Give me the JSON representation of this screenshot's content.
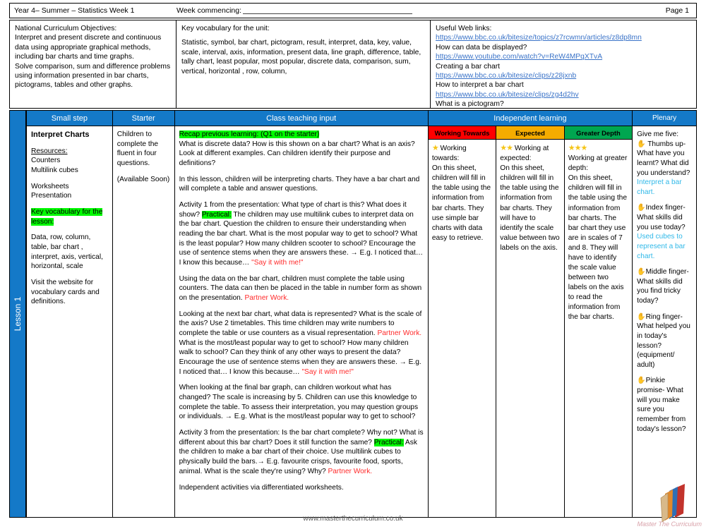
{
  "header": {
    "year_term": "Year 4– Summer – Statistics Week 1",
    "week_commencing_label": "Week commencing:",
    "page": "Page 1"
  },
  "info": {
    "nc": {
      "heading": "National Curriculum Objectives:",
      "body1": "Interpret and present discrete and continuous data using appropriate graphical methods, including bar charts and time graphs.",
      "body2": "Solve comparison, sum and difference problems using information presented in bar charts, pictograms, tables and other graphs."
    },
    "vocab": {
      "heading": "Key vocabulary for the unit:",
      "body": "Statistic, symbol, bar chart, pictogram, result, interpret, data, key, value, scale, interval, axis, information, present data, line graph, difference, table, tally chart, least popular, most popular, discrete data, comparison, sum, vertical, horizontal , row, column,"
    },
    "links": {
      "heading": "Useful Web links:",
      "items": [
        {
          "url": "https://www.bbc.co.uk/bitesize/topics/z7rcwmn/articles/z8dp8mn",
          "caption": "How can data be displayed?"
        },
        {
          "url": "https://www.youtube.com/watch?v=ReW4MPqXTvA",
          "caption": "Creating a bar chart"
        },
        {
          "url": "https://www.bbc.co.uk/bitesize/clips/z28jxnb",
          "caption": "How to interpret a bar chart"
        },
        {
          "url": "https://www.bbc.co.uk/bitesize/clips/zg4d2hv",
          "caption": "What is a pictogram?"
        }
      ]
    }
  },
  "lesson_strip": {
    "label": "Lesson 1"
  },
  "columns": {
    "small_step": "Small step",
    "starter": "Starter",
    "class_teaching": "Class teaching input",
    "independent": "Independent learning",
    "plenary": "Plenary"
  },
  "small_step": {
    "title": "Interpret Charts",
    "resources_heading": "Resources:",
    "resources": [
      "Counters",
      "Multilink cubes"
    ],
    "materials": [
      "Worksheets",
      "Presentation"
    ],
    "key_vocab_heading": "Key vocabulary for the lesson:",
    "key_vocab_body": "Data, row, column, table, bar chart , interpret, axis, vertical, horizontal, scale",
    "website_note": "Visit the website for vocabulary cards and definitions."
  },
  "starter": {
    "text": "Children to complete the fluent in four questions.",
    "availability": "(Available Soon)"
  },
  "teaching": {
    "recap_highlight": "Recap previous learning: (Q1 on the starter)",
    "p1_rest": "What is discrete data? How is this shown on a bar chart? What is an axis? Look at different examples. Can children identify their purpose and definitions?",
    "p2": "In this lesson, children will be interpreting charts. They have a bar chart and will complete a table and answer questions.",
    "p3_a": "Activity 1 from the presentation: What type of chart is this? What does it show? ",
    "p3_practical": "Practical:",
    "p3_b": " The children may use multilink cubes to interpret data on the bar chart. Question the children to ensure their understanding when reading the bar chart. What is the most popular way to get to school? What is the least popular? How many children scooter to school? Encourage the use of sentence stems when they are answers these. → E.g. I noticed that… I know this because… ",
    "p3_red": "\"Say it with me!\"",
    "p4_a": "Using the data on the bar chart, children must complete the table using counters. The data can then be placed in the table in number form as shown on the presentation. ",
    "p4_red": "Partner Work.",
    "p5_a": "Looking at the next bar chart, what data is represented? What is the scale of the axis? Use 2 timetables. This time children may write numbers to complete the table or use counters as a visual representation. ",
    "p5_red1": "Partner Work.",
    "p5_b": " What is the most/least popular way to get to school? How many children walk to school? Can they think of any other ways to present the data? Encourage the use of sentence stems when they are answers these. → E.g. I noticed that… I know this because… ",
    "p5_red2": "\"Say it with me!\"",
    "p6": "When looking at the final bar graph, can children workout what has changed?  The scale is increasing by 5. Children can use this knowledge to complete the table. To assess their interpretation, you may question groups or individuals. → E.g. What is the most/least popular way to get to school?",
    "p7_a": "Activity 3 from the presentation: Is the bar chart complete? Why not? What is different about this bar chart? Does it still function the same? ",
    "p7_practical": "Practical:",
    "p7_b": " Ask the children to make a bar chart of their choice. Use multilink cubes to physically build the bars.→ E.g. favourite crisps, favourite food, sports, animal. What is the scale they're using? Why? ",
    "p7_red": "Partner Work.",
    "p8": "Independent activities via differentiated worksheets."
  },
  "independent": {
    "bands": [
      {
        "label": "Working Towards",
        "color": "#ff0000",
        "stars": "★",
        "lead": "Working towards:",
        "body": "On this sheet, children will fill in the table using the information from bar charts. They use simple bar charts with data easy to retrieve."
      },
      {
        "label": "Expected",
        "color": "#f5ac00",
        "stars": "★★",
        "lead": "Working at expected:",
        "body": " On this sheet, children will fill in the table using the information from bar charts. They will have to identify the scale value between two labels on the axis."
      },
      {
        "label": "Greater Depth",
        "color": "#00a650",
        "stars": "★★★",
        "lead": "Working at greater depth:",
        "body": "On this sheet, children will fill in the table using the information from bar charts. The bar chart they use are in scales of 7 and 8. They will have to identify the scale value between two labels on the axis to read the information from the bar charts."
      }
    ]
  },
  "plenary": {
    "intro": "Give me five:",
    "items": [
      {
        "hand": "✋",
        "question": " Thumbs up- What have you learnt? What did you understand?",
        "answer": "Interpret a bar chart."
      },
      {
        "hand": "✋",
        "question": "Index finger- What skills did you use today?",
        "answer": "Used cubes to represent a bar chart."
      },
      {
        "hand": "✋",
        "question": "Middle finger- What skills did you find tricky today?",
        "answer": ""
      },
      {
        "hand": "✋",
        "question": "Ring finger- What helped you in today's lesson? (equipment/ adult)",
        "answer": ""
      },
      {
        "hand": "✋",
        "question": "Pinkie promise- What will you make sure you remember from today's lesson?",
        "answer": ""
      }
    ]
  },
  "footer": {
    "url": "www.masterthecurriculum.co.uk",
    "logo_text": "Master The Curriculum"
  },
  "colors": {
    "header_blue": "#1479c8",
    "highlight_green": "#00f900",
    "red_text": "#ff2a2a",
    "cyan_text": "#2fb8e8",
    "link_blue": "#3a73c8"
  }
}
